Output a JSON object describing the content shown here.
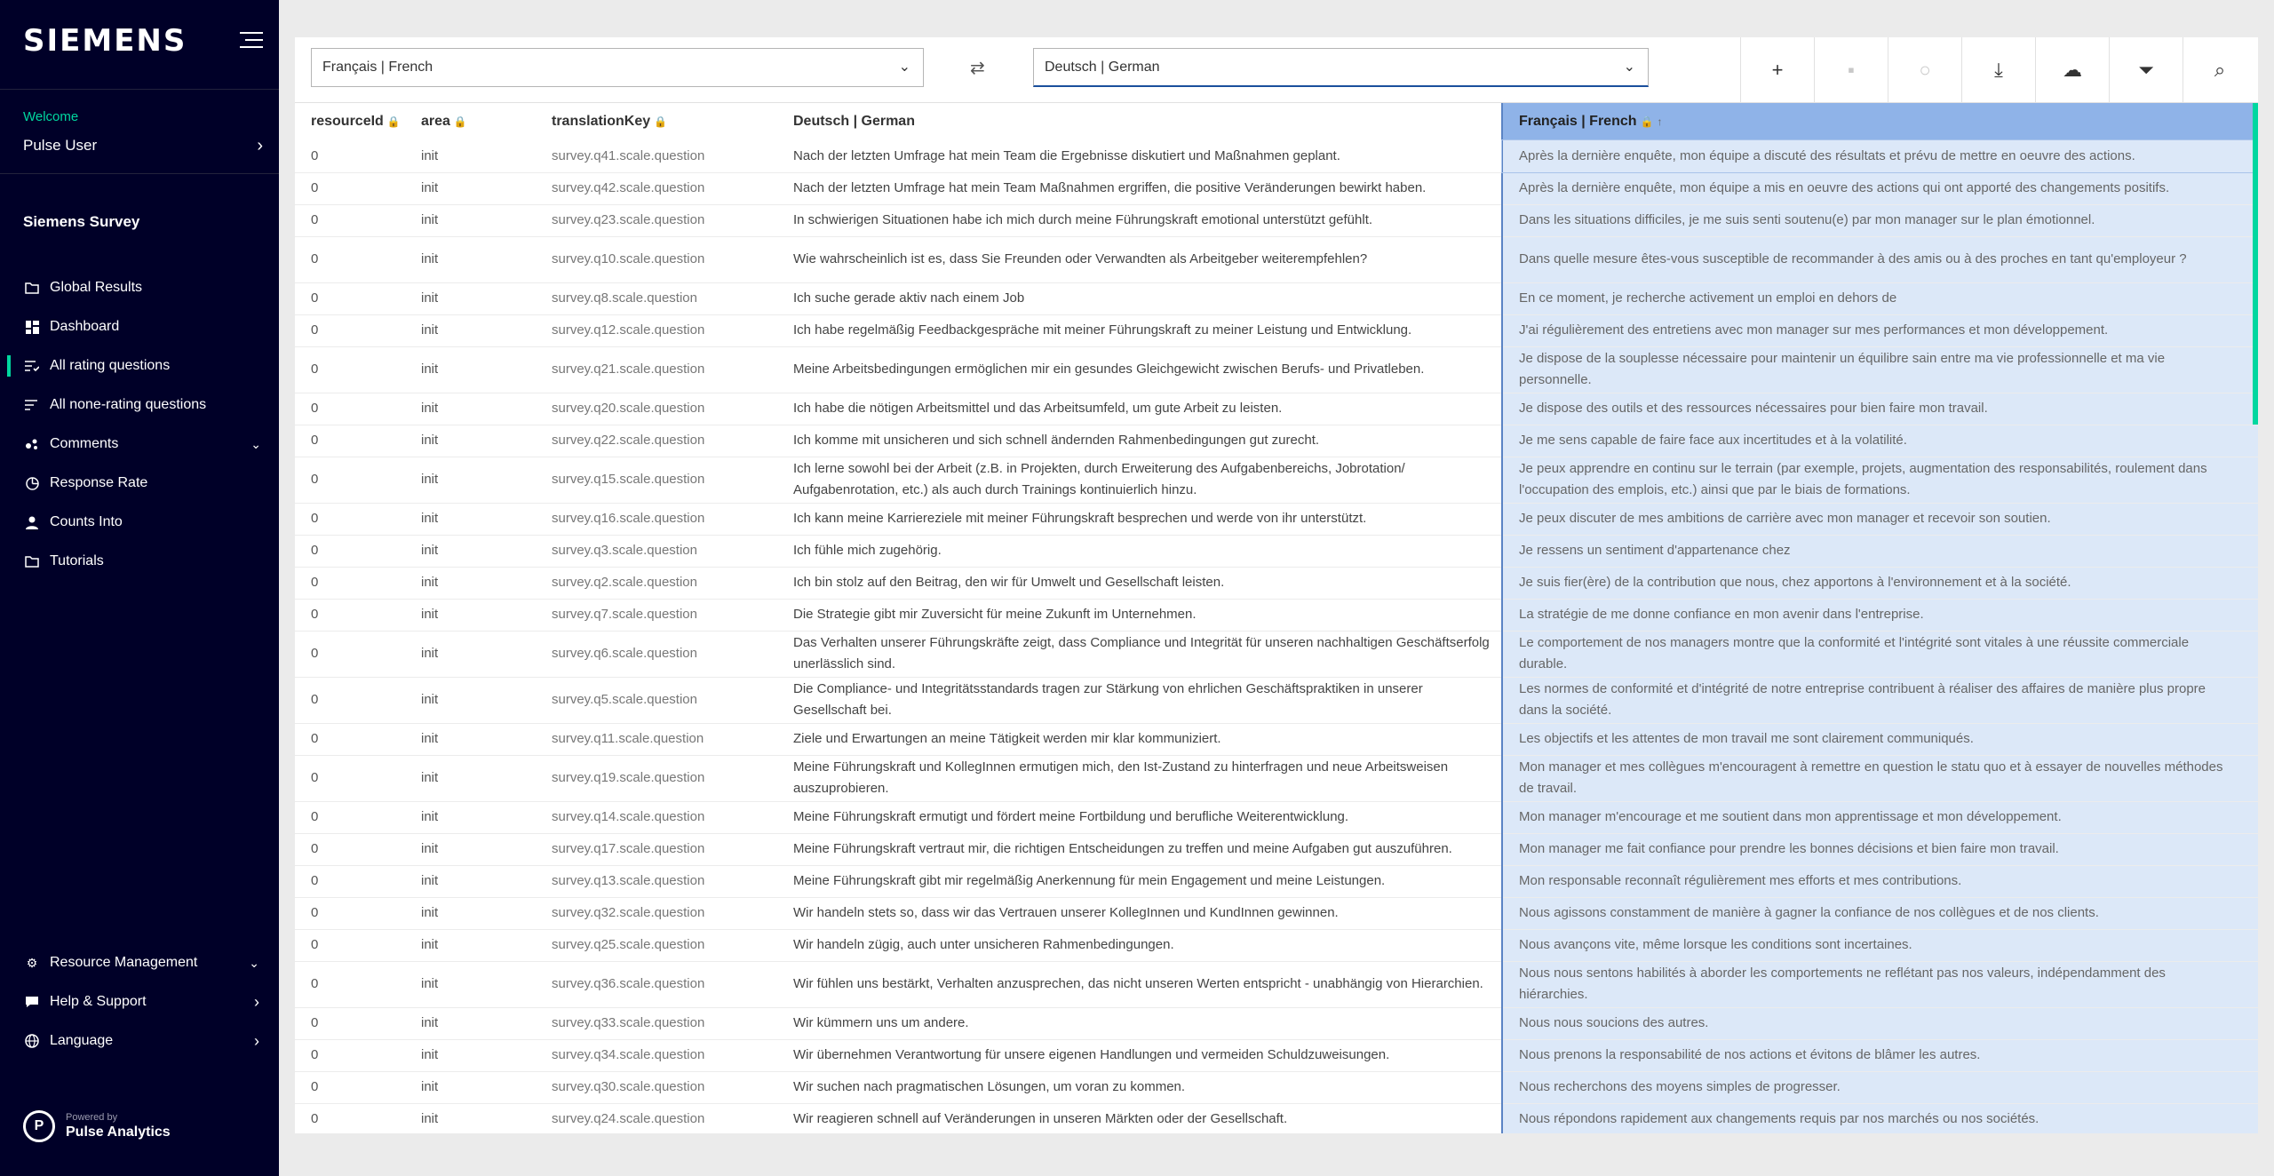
{
  "sidebar": {
    "brand": "SIEMENS",
    "welcome": "Welcome",
    "user": "Pulse User",
    "survey_title": "Siemens Survey",
    "nav": [
      {
        "label": "Global Results",
        "icon": "folder-icon"
      },
      {
        "label": "Dashboard",
        "icon": "dashboard-icon"
      },
      {
        "label": "All rating questions",
        "icon": "rating-list-icon"
      },
      {
        "label": "All none-rating questions",
        "icon": "list-icon"
      },
      {
        "label": "Comments",
        "icon": "comments-icon"
      },
      {
        "label": "Response Rate",
        "icon": "pie-icon"
      },
      {
        "label": "Counts Into",
        "icon": "person-icon"
      },
      {
        "label": "Tutorials",
        "icon": "folder-icon"
      }
    ],
    "bottom_nav": [
      {
        "label": "Resource Management",
        "icon": "gear-icon"
      },
      {
        "label": "Help & Support",
        "icon": "chat-icon"
      },
      {
        "label": "Language",
        "icon": "globe-icon"
      }
    ],
    "powered_by": "Powered by",
    "product": "Pulse Analytics"
  },
  "toolbar": {
    "source_language": "Français | French",
    "target_language": "Deutsch | German"
  },
  "table": {
    "headers": {
      "resource_id": "resourceId",
      "area": "area",
      "translation_key": "translationKey",
      "german": "Deutsch | German",
      "french": "Français | French"
    },
    "rows": [
      {
        "id": "0",
        "area": "init",
        "key": "survey.q41.scale.question",
        "de": "Nach der letzten Umfrage hat mein Team die Ergebnisse diskutiert und Maßnahmen geplant.",
        "fr": "Après la dernière enquête, mon équipe a discuté des résultats et prévu de mettre en oeuvre des actions."
      },
      {
        "id": "0",
        "area": "init",
        "key": "survey.q42.scale.question",
        "de": "Nach der letzten Umfrage hat mein Team Maßnahmen ergriffen, die positive Veränderungen bewirkt haben.",
        "fr": "Après la dernière enquête, mon équipe a mis en oeuvre des actions qui ont apporté des changements positifs."
      },
      {
        "id": "0",
        "area": "init",
        "key": "survey.q23.scale.question",
        "de": "In schwierigen Situationen habe ich mich durch meine Führungskraft emotional unterstützt gefühlt.",
        "fr": "Dans les situations difficiles, je me suis senti soutenu(e) par mon manager sur le plan émotionnel."
      },
      {
        "id": "0",
        "area": "init",
        "key": "survey.q10.scale.question",
        "de": "Wie wahrscheinlich ist es, dass Sie Freunden oder Verwandten als Arbeitgeber weiterempfehlen?",
        "fr": "Dans quelle mesure êtes-vous susceptible de recommander                          à des amis ou à des proches en tant qu'employeur ?"
      },
      {
        "id": "0",
        "area": "init",
        "key": "survey.q8.scale.question",
        "de": "Ich suche gerade aktiv nach einem Job",
        "fr": "En ce moment, je recherche activement un emploi en dehors de"
      },
      {
        "id": "0",
        "area": "init",
        "key": "survey.q12.scale.question",
        "de": "Ich habe regelmäßig Feedbackgespräche mit meiner Führungskraft zu meiner Leistung und Entwicklung.",
        "fr": "J'ai régulièrement des entretiens avec mon manager sur mes performances et mon développement."
      },
      {
        "id": "0",
        "area": "init",
        "key": "survey.q21.scale.question",
        "de": "Meine Arbeitsbedingungen ermöglichen mir ein gesundes Gleichgewicht zwischen Berufs- und Privatleben.",
        "fr": "Je dispose de la souplesse nécessaire pour maintenir un équilibre sain entre ma vie professionnelle et ma vie personnelle."
      },
      {
        "id": "0",
        "area": "init",
        "key": "survey.q20.scale.question",
        "de": "Ich habe die nötigen Arbeitsmittel und das Arbeitsumfeld, um gute Arbeit zu leisten.",
        "fr": "Je dispose des outils et des ressources nécessaires pour bien faire mon travail."
      },
      {
        "id": "0",
        "area": "init",
        "key": "survey.q22.scale.question",
        "de": "Ich komme mit unsicheren und sich schnell ändernden Rahmenbedingungen gut zurecht.",
        "fr": "Je me sens capable de faire face aux incertitudes et à la volatilité."
      },
      {
        "id": "0",
        "area": "init",
        "key": "survey.q15.scale.question",
        "de": "Ich lerne sowohl bei der Arbeit (z.B. in Projekten, durch Erweiterung des Aufgabenbereichs, Jobrotation/ Aufgabenrotation, etc.) als auch durch Trainings kontinuierlich hinzu.",
        "fr": "Je peux apprendre en continu sur le terrain (par exemple, projets, augmentation des responsabilités, roulement dans l'occupation des emplois, etc.) ainsi que par le biais de formations."
      },
      {
        "id": "0",
        "area": "init",
        "key": "survey.q16.scale.question",
        "de": "Ich kann meine Karriereziele mit meiner Führungskraft besprechen und werde von ihr unterstützt.",
        "fr": "Je peux discuter de mes ambitions de carrière avec mon manager et recevoir son soutien."
      },
      {
        "id": "0",
        "area": "init",
        "key": "survey.q3.scale.question",
        "de": "Ich fühle mich  zugehörig.",
        "fr": "Je ressens un sentiment d'appartenance chez"
      },
      {
        "id": "0",
        "area": "init",
        "key": "survey.q2.scale.question",
        "de": "Ich bin stolz auf den Beitrag, den wir  für Umwelt und Gesellschaft leisten.",
        "fr": "Je suis fier(ère) de la contribution que nous, chez                      apportons à l'environnement et à la société."
      },
      {
        "id": "0",
        "area": "init",
        "key": "survey.q7.scale.question",
        "de": "Die Strategie  gibt mir Zuversicht für meine Zukunft im Unternehmen.",
        "fr": "La stratégie de                          me donne confiance en mon avenir dans l'entreprise."
      },
      {
        "id": "0",
        "area": "init",
        "key": "survey.q6.scale.question",
        "de": "Das Verhalten unserer Führungskräfte zeigt, dass Compliance und Integrität für unseren nachhaltigen Geschäftserfolg unerlässlich sind.",
        "fr": "Le comportement de nos managers montre que la conformité et l'intégrité sont vitales à une réussite commerciale durable."
      },
      {
        "id": "0",
        "area": "init",
        "key": "survey.q5.scale.question",
        "de": "Die Compliance- und Integritätsstandards  tragen zur Stärkung von ehrlichen Geschäftspraktiken in unserer Gesellschaft bei.",
        "fr": "Les normes de conformité et d'intégrité de notre entreprise contribuent à réaliser des affaires de manière plus propre dans la société."
      },
      {
        "id": "0",
        "area": "init",
        "key": "survey.q11.scale.question",
        "de": "Ziele und Erwartungen an meine Tätigkeit werden mir klar kommuniziert.",
        "fr": "Les objectifs et les attentes de mon travail me sont clairement communiqués."
      },
      {
        "id": "0",
        "area": "init",
        "key": "survey.q19.scale.question",
        "de": "Meine Führungskraft und KollegInnen ermutigen mich, den Ist-Zustand zu hinterfragen und neue Arbeitsweisen auszuprobieren.",
        "fr": "Mon manager et mes collègues m'encouragent à remettre en question le statu quo et à essayer de nouvelles méthodes de travail."
      },
      {
        "id": "0",
        "area": "init",
        "key": "survey.q14.scale.question",
        "de": "Meine Führungskraft ermutigt und fördert meine Fortbildung und berufliche Weiterentwicklung.",
        "fr": "Mon manager m'encourage et me soutient dans mon apprentissage et mon développement."
      },
      {
        "id": "0",
        "area": "init",
        "key": "survey.q17.scale.question",
        "de": "Meine Führungskraft vertraut mir, die richtigen Entscheidungen zu treffen und meine Aufgaben gut auszuführen.",
        "fr": "Mon manager me fait confiance pour prendre les bonnes décisions et bien faire mon travail."
      },
      {
        "id": "0",
        "area": "init",
        "key": "survey.q13.scale.question",
        "de": "Meine Führungskraft gibt mir regelmäßig Anerkennung für mein Engagement und meine Leistungen.",
        "fr": "Mon responsable reconnaît régulièrement mes efforts et mes contributions."
      },
      {
        "id": "0",
        "area": "init",
        "key": "survey.q32.scale.question",
        "de": "Wir handeln stets so,  dass wir das Vertrauen unserer KollegInnen und KundInnen gewinnen.",
        "fr": "Nous agissons constamment de manière à gagner la confiance de nos collègues et de nos clients."
      },
      {
        "id": "0",
        "area": "init",
        "key": "survey.q25.scale.question",
        "de": "Wir handeln zügig, auch unter unsicheren Rahmenbedingungen.",
        "fr": "Nous avançons vite, même lorsque les conditions sont incertaines."
      },
      {
        "id": "0",
        "area": "init",
        "key": "survey.q36.scale.question",
        "de": "Wir fühlen uns bestärkt,  Verhalten anzusprechen, das nicht unseren Werten entspricht  - unabhängig von Hierarchien.",
        "fr": "Nous nous sentons habilités à aborder les comportements ne reflétant pas nos valeurs, indépendamment des hiérarchies."
      },
      {
        "id": "0",
        "area": "init",
        "key": "survey.q33.scale.question",
        "de": "Wir kümmern uns um andere.",
        "fr": "Nous nous soucions des autres."
      },
      {
        "id": "0",
        "area": "init",
        "key": "survey.q34.scale.question",
        "de": "Wir übernehmen Verantwortung für unsere eigenen Handlungen und vermeiden Schuldzuweisungen.",
        "fr": "Nous prenons la responsabilité de nos actions et évitons de blâmer les autres."
      },
      {
        "id": "0",
        "area": "init",
        "key": "survey.q30.scale.question",
        "de": "Wir suchen nach pragmatischen Lösungen, um voran zu kommen.",
        "fr": "Nous recherchons des moyens simples de progresser."
      },
      {
        "id": "0",
        "area": "init",
        "key": "survey.q24.scale.question",
        "de": "Wir reagieren schnell auf Veränderungen in unseren Märkten oder der Gesellschaft.",
        "fr": "Nous répondons rapidement aux changements requis par nos marchés ou nos sociétés."
      }
    ]
  }
}
